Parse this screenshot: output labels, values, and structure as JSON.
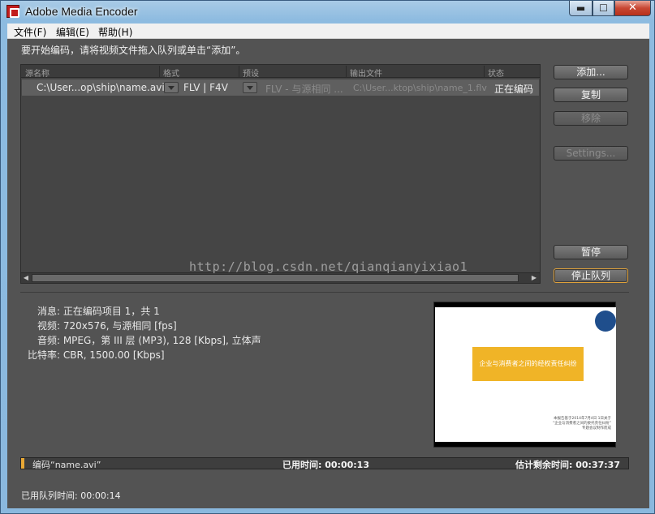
{
  "window": {
    "title": "Adobe Media Encoder",
    "controls": {
      "minimize": "▬",
      "maximize": "☐",
      "close": "✕"
    }
  },
  "menubar": {
    "items": [
      {
        "label": "文件(F)"
      },
      {
        "label": "编辑(E)"
      },
      {
        "label": "帮助(H)"
      }
    ]
  },
  "hint": "要开始编码，请将视频文件拖入队列或单击“添加”。",
  "queue": {
    "columns": [
      "源名称",
      "格式",
      "预设",
      "输出文件",
      "状态"
    ],
    "rows": [
      {
        "source": "C:\\User...op\\ship\\name.avi",
        "format": "FLV | F4V",
        "preset": "FLV - 与源相同 ...",
        "output": "C:\\User...ktop\\ship\\name_1.flv",
        "status": "正在编码"
      }
    ]
  },
  "buttons": {
    "add": "添加...",
    "duplicate": "复制",
    "remove": "移除",
    "settings": "Settings...",
    "pause": "暂停",
    "stop_queue": "停止队列"
  },
  "info": {
    "message_label": "消息:",
    "message_value": "正在编码项目 1，共 1",
    "video_label": "视频:",
    "video_value": "720x576, 与源相同 [fps]",
    "audio_label": "音频:",
    "audio_value": "MPEG，第 III 层 (MP3), 128 [Kbps], 立体声",
    "bitrate_label": "比特率:",
    "bitrate_value": "CBR, 1500.00 [Kbps]"
  },
  "preview": {
    "slide_title": "企业与消费者之间的经权责任纠纷",
    "notes_line1": "本报告基于2014年7月4日 1日关于",
    "notes_line2": "“企业与消费者之间的委托责任纠纷”",
    "notes_line3": "专题会议制作而成"
  },
  "progress": {
    "file_label": "编码“name.avi”",
    "elapsed_label": "已用时间:",
    "elapsed_value": "00:00:13",
    "remaining_label": "估计剩余时间:",
    "remaining_value": "00:37:37",
    "fraction": 0.006
  },
  "queue_time": {
    "label": "已用队列时间:",
    "value": "00:00:14"
  },
  "watermark": "http://blog.csdn.net/qianqianyixiao1",
  "colors": {
    "accent": "#e8a835",
    "panel": "#535353"
  }
}
